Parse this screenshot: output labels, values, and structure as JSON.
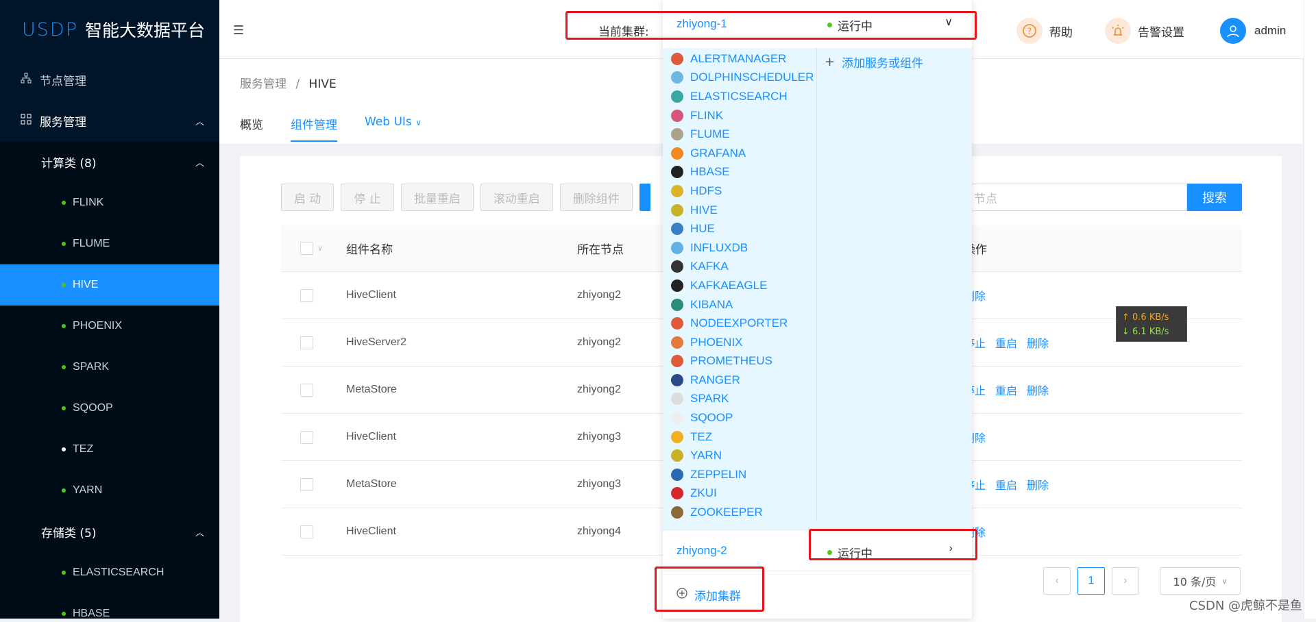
{
  "app": {
    "logo_mark": "USDP",
    "logo_text": "智能大数据平台"
  },
  "sidebar": {
    "node_mgmt": "节点管理",
    "service_mgmt": "服务管理",
    "compute_group": "计算类 (8)",
    "compute_items": [
      "FLINK",
      "FLUME",
      "HIVE",
      "PHOENIX",
      "SPARK",
      "SQOOP",
      "TEZ",
      "YARN"
    ],
    "storage_group": "存储类 (5)",
    "storage_items": [
      "ELASTICSEARCH",
      "HBASE"
    ]
  },
  "header": {
    "cluster_label": "当前集群:",
    "help": "帮助",
    "alarm": "告警设置",
    "user": "admin"
  },
  "breadcrumb": {
    "parent": "服务管理",
    "sep": "/",
    "current": "HIVE"
  },
  "tabs": {
    "overview": "概览",
    "components": "组件管理",
    "webuis": "Web UIs"
  },
  "toolbar": {
    "start": "启 动",
    "stop": "停 止",
    "batch_restart": "批量重启",
    "rolling_restart": "滚动重启",
    "delete": "删除组件"
  },
  "search": {
    "placeholder_tail": "节点",
    "button": "搜索"
  },
  "table": {
    "headers": {
      "name": "组件名称",
      "node": "所在节点",
      "ops": "操作"
    },
    "rows": [
      {
        "name": "HiveClient",
        "node": "zhiyong2",
        "ops": [
          "删除"
        ]
      },
      {
        "name": "HiveServer2",
        "node": "zhiyong2",
        "ops": [
          "停止",
          "重启",
          "删除"
        ]
      },
      {
        "name": "MetaStore",
        "node": "zhiyong2",
        "ops": [
          "停止",
          "重启",
          "删除"
        ]
      },
      {
        "name": "HiveClient",
        "node": "zhiyong3",
        "ops": [
          "删除"
        ]
      },
      {
        "name": "MetaStore",
        "node": "zhiyong3",
        "ops": [
          "停止",
          "重启",
          "删除"
        ]
      },
      {
        "name": "HiveClient",
        "node": "zhiyong4",
        "ops": [
          "删除"
        ]
      }
    ]
  },
  "pagination": {
    "page": "1",
    "size": "10 条/页"
  },
  "dropdown": {
    "cluster1": "zhiyong-1",
    "cluster1_status": "运行中",
    "services": [
      "ALERTMANAGER",
      "DOLPHINSCHEDULER",
      "ELASTICSEARCH",
      "FLINK",
      "FLUME",
      "GRAFANA",
      "HBASE",
      "HDFS",
      "HIVE",
      "HUE",
      "INFLUXDB",
      "KAFKA",
      "KAFKAEAGLE",
      "KIBANA",
      "NODEEXPORTER",
      "PHOENIX",
      "PROMETHEUS",
      "RANGER",
      "SPARK",
      "SQOOP",
      "TEZ",
      "YARN",
      "ZEPPELIN",
      "ZKUI",
      "ZOOKEEPER"
    ],
    "service_icon_colors": [
      "#e05a3a",
      "#6fb7e0",
      "#3aa7a1",
      "#d4577b",
      "#a9a38a",
      "#f08a24",
      "#222222",
      "#d9b32a",
      "#c9b227",
      "#3a7fc2",
      "#5fb1e6",
      "#333333",
      "#222222",
      "#2a8c7a",
      "#e05a3a",
      "#e67a3c",
      "#e05a3a",
      "#2a4a8a",
      "#dddddd",
      "#eeeeee",
      "#f0b020",
      "#c9b227",
      "#2a6ab0",
      "#d8262d",
      "#8a6a3a"
    ],
    "add_service": "添加服务或组件",
    "cluster2": "zhiyong-2",
    "cluster2_status": "运行中",
    "add_cluster": "添加集群"
  },
  "net": {
    "up": "↑ 0.6 KB/s",
    "down": "↓ 6.1 KB/s"
  },
  "watermark": "CSDN @虎鲸不是鱼"
}
